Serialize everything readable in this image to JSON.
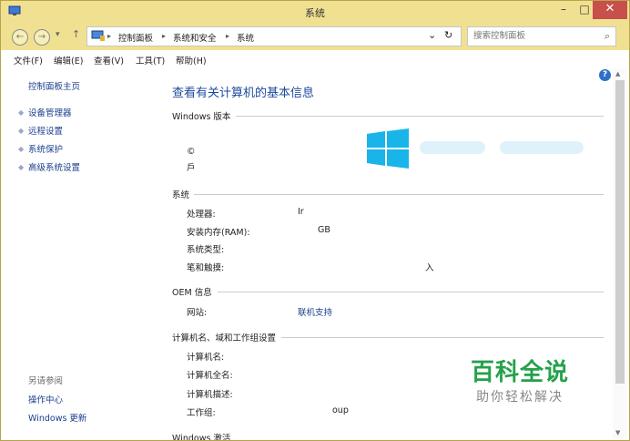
{
  "window": {
    "title": "系统",
    "minimize": "–",
    "maximize": "□",
    "close": "✕"
  },
  "address": {
    "back": "←",
    "forward": "→",
    "dropdown": "▾",
    "up": "↑",
    "breadcrumb": [
      "控制面板",
      "系统和安全",
      "系统"
    ],
    "sep": "▸",
    "addr_dropdown": "⌄",
    "refresh": "↻"
  },
  "search": {
    "placeholder": "搜索控制面板",
    "icon": "⌕"
  },
  "menu": [
    "文件(F)",
    "编辑(E)",
    "查看(V)",
    "工具(T)",
    "帮助(H)"
  ],
  "sidebar": {
    "home": "控制面板主页",
    "items": [
      "设备管理器",
      "远程设置",
      "系统保护",
      "高级系统设置"
    ],
    "see_also": "另请参阅",
    "see_also_items": [
      "操作中心",
      "Windows 更新"
    ]
  },
  "main": {
    "title": "查看有关计算机的基本信息",
    "edition": {
      "header": "Windows 版本",
      "copyright_partial": "© ",
      "rights_partial": "戶"
    },
    "system": {
      "header": "系统",
      "rows": [
        {
          "label": "处理器:",
          "value": "Ir"
        },
        {
          "label": "安装内存(RAM):",
          "value": "GB"
        },
        {
          "label": "系统类型:",
          "value": ""
        },
        {
          "label": "笔和触摸:",
          "value": "入"
        }
      ]
    },
    "oem": {
      "header": "OEM 信息",
      "site_label": "网站:",
      "site_link": "联机支持"
    },
    "computer": {
      "header": "计算机名、域和工作组设置",
      "rows": [
        {
          "label": "计算机名:",
          "value": ""
        },
        {
          "label": "计算机全名:",
          "value": ""
        },
        {
          "label": "计算机描述:",
          "value": ""
        },
        {
          "label": "工作组:",
          "value": "oup"
        }
      ]
    },
    "activation": {
      "header": "Windows 激活"
    }
  },
  "help": "?",
  "watermark": {
    "title": "百科全说",
    "subtitle": "助你轻松解决"
  },
  "colors": {
    "titlebar": "#f0e192",
    "close": "#c7504b",
    "link": "#1a3f8c",
    "heading": "#1c4a9c",
    "win_logo": "#19b4ea",
    "watermark": "#25a14b"
  }
}
